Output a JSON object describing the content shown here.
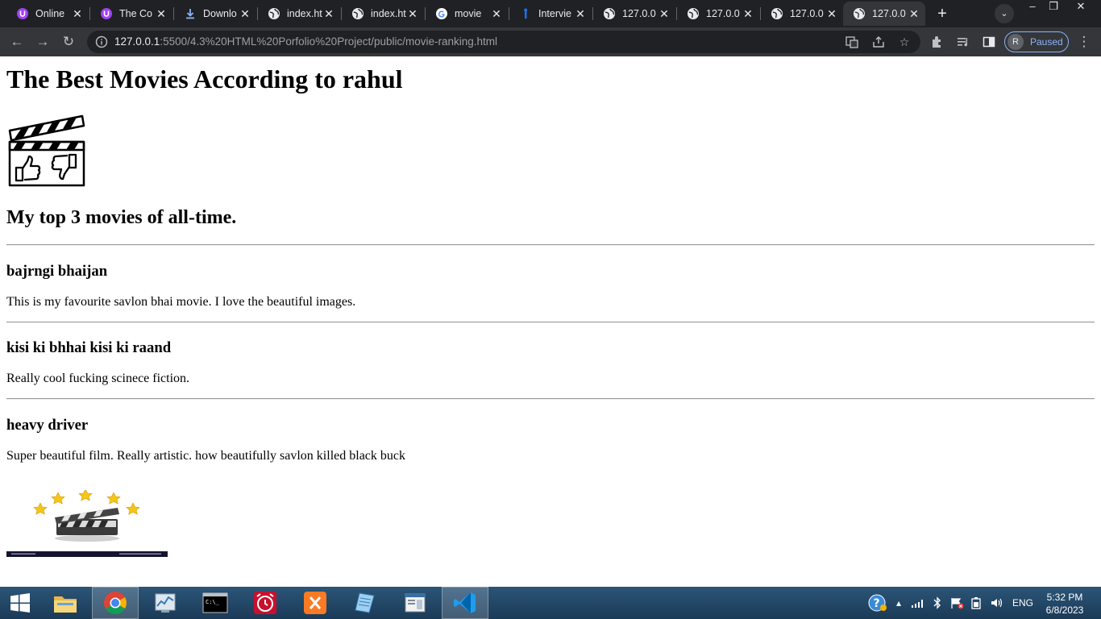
{
  "browser": {
    "tabs": [
      {
        "title": "Online",
        "icon": "u-circle-icon"
      },
      {
        "title": "The Co",
        "icon": "u-circle-icon"
      },
      {
        "title": "Downlo",
        "icon": "download-icon"
      },
      {
        "title": "index.ht",
        "icon": "globe-icon"
      },
      {
        "title": "index.ht",
        "icon": "globe-icon"
      },
      {
        "title": "movie",
        "icon": "google-icon"
      },
      {
        "title": "Intervie",
        "icon": "bookmark-icon"
      },
      {
        "title": "127.0.0",
        "icon": "globe-icon"
      },
      {
        "title": "127.0.0",
        "icon": "globe-icon"
      },
      {
        "title": "127.0.0",
        "icon": "globe-icon"
      },
      {
        "title": "127.0.0",
        "icon": "globe-icon"
      }
    ],
    "active_tab": 10,
    "url_host": "127.0.0.1",
    "url_rest": ":5500/4.3%20HTML%20Porfolio%20Project/public/movie-ranking.html",
    "profile_initial": "R",
    "profile_status": "Paused",
    "colors": {
      "frame": "#202124",
      "toolbar": "#35363a",
      "accent": "#8ab4f8"
    }
  },
  "page": {
    "title": "The Best Movies According to rahul",
    "subtitle": "My top 3 movies of all-time.",
    "movies": [
      {
        "name": "bajrngi bhaijan",
        "description": "This is my favourite savlon bhai movie. I love the beautiful images."
      },
      {
        "name": "kisi ki bhhai kisi ki raand",
        "description": "Really cool fucking scinece fiction."
      },
      {
        "name": "heavy driver",
        "description": "Super beautiful film. Really artistic. how beautifully savlon killed black buck"
      }
    ],
    "rating_stars": 5
  },
  "taskbar": {
    "apps": [
      "windows-explorer-icon",
      "chrome-icon",
      "performance-monitor-icon",
      "command-prompt-icon",
      "alarm-clock-icon",
      "xampp-icon",
      "notepad-icon",
      "document-viewer-icon",
      "vscode-icon"
    ],
    "language": "ENG",
    "time": "5:32 PM",
    "date": "6/8/2023"
  }
}
